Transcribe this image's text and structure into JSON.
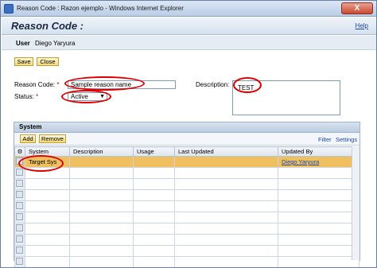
{
  "window": {
    "title": "Reason Code : Razon ejemplo - Windows Internet Explorer",
    "close_label": "X"
  },
  "header": {
    "title": "Reason Code :",
    "help_label": "Help"
  },
  "user": {
    "label": "User",
    "value": "Diego Yaryura"
  },
  "toolbar": {
    "save_label": "Save",
    "close_label": "Close"
  },
  "form": {
    "reason_code_label": "Reason Code:",
    "reason_code_value": "Sample reason name",
    "status_label": "Status:",
    "status_value": "Active",
    "description_label": "Description:",
    "description_value": "TEST"
  },
  "system": {
    "title": "System",
    "add_label": "Add",
    "remove_label": "Remove",
    "filter_label": "Filter",
    "settings_label": "Settings",
    "columns": [
      "System",
      "Description",
      "Usage",
      "Last Updated",
      "Updated By"
    ],
    "rows": [
      {
        "system": "Target Sys",
        "description": "",
        "usage": "",
        "last_updated": "",
        "updated_by": "Diego Yaryura"
      }
    ]
  }
}
